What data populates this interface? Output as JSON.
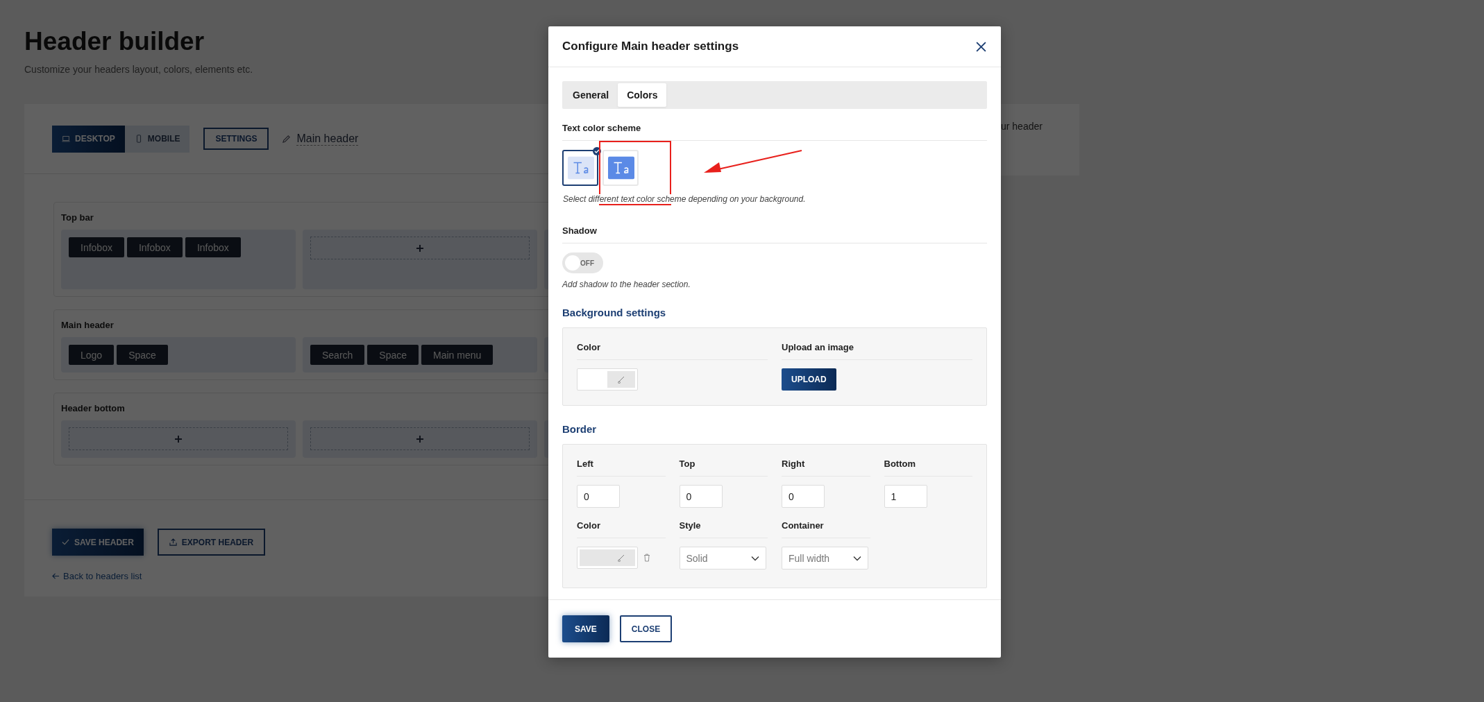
{
  "page": {
    "title": "Header builder",
    "subtitle": "Customize your headers layout, colors, elements etc."
  },
  "toolbar": {
    "devices": [
      {
        "label": "DESKTOP",
        "kind": "desktop",
        "selected": true
      },
      {
        "label": "MOBILE",
        "kind": "mobile",
        "selected": false
      }
    ],
    "settings_button": "SETTINGS",
    "header_name": "Main header"
  },
  "sections": [
    {
      "title": "Top bar",
      "zones": [
        {
          "kind": "elements",
          "items": [
            "Infobox",
            "Infobox",
            "Infobox"
          ]
        },
        {
          "kind": "empty"
        }
      ]
    },
    {
      "title": "Main header",
      "zones": [
        {
          "kind": "elements",
          "items": [
            "Logo",
            "Space"
          ]
        },
        {
          "kind": "elements",
          "items": [
            "Search",
            "Space",
            "Main menu"
          ]
        }
      ]
    },
    {
      "title": "Header bottom",
      "zones": [
        {
          "kind": "empty"
        },
        {
          "kind": "empty"
        }
      ]
    }
  ],
  "actions": {
    "save": "SAVE HEADER",
    "export": "EXPORT HEADER",
    "back_link": "Back to headers list"
  },
  "side_panel": {
    "text": "ur header"
  },
  "modal": {
    "title": "Configure Main header settings",
    "tabs": [
      {
        "label": "General",
        "selected": false
      },
      {
        "label": "Colors",
        "selected": true
      }
    ],
    "text_color_scheme": {
      "label": "Text color scheme",
      "options": [
        {
          "kind": "light",
          "selected": true
        },
        {
          "kind": "dark",
          "selected": false
        }
      ],
      "help": "Select different text color scheme depending on your background."
    },
    "shadow": {
      "label": "Shadow",
      "on": false,
      "toggle_label": "OFF",
      "help": "Add shadow to the header section."
    },
    "background": {
      "heading": "Background settings",
      "color_label": "Color",
      "upload_label": "Upload an image",
      "upload_button": "UPLOAD"
    },
    "border": {
      "heading": "Border",
      "sides": [
        {
          "label": "Left",
          "value": "0"
        },
        {
          "label": "Top",
          "value": "0"
        },
        {
          "label": "Right",
          "value": "0"
        },
        {
          "label": "Bottom",
          "value": "1"
        }
      ],
      "color_label": "Color",
      "style_label": "Style",
      "style_value": "Solid",
      "container_label": "Container",
      "container_value": "Full width"
    },
    "buttons": {
      "save": "SAVE",
      "close": "CLOSE"
    }
  }
}
